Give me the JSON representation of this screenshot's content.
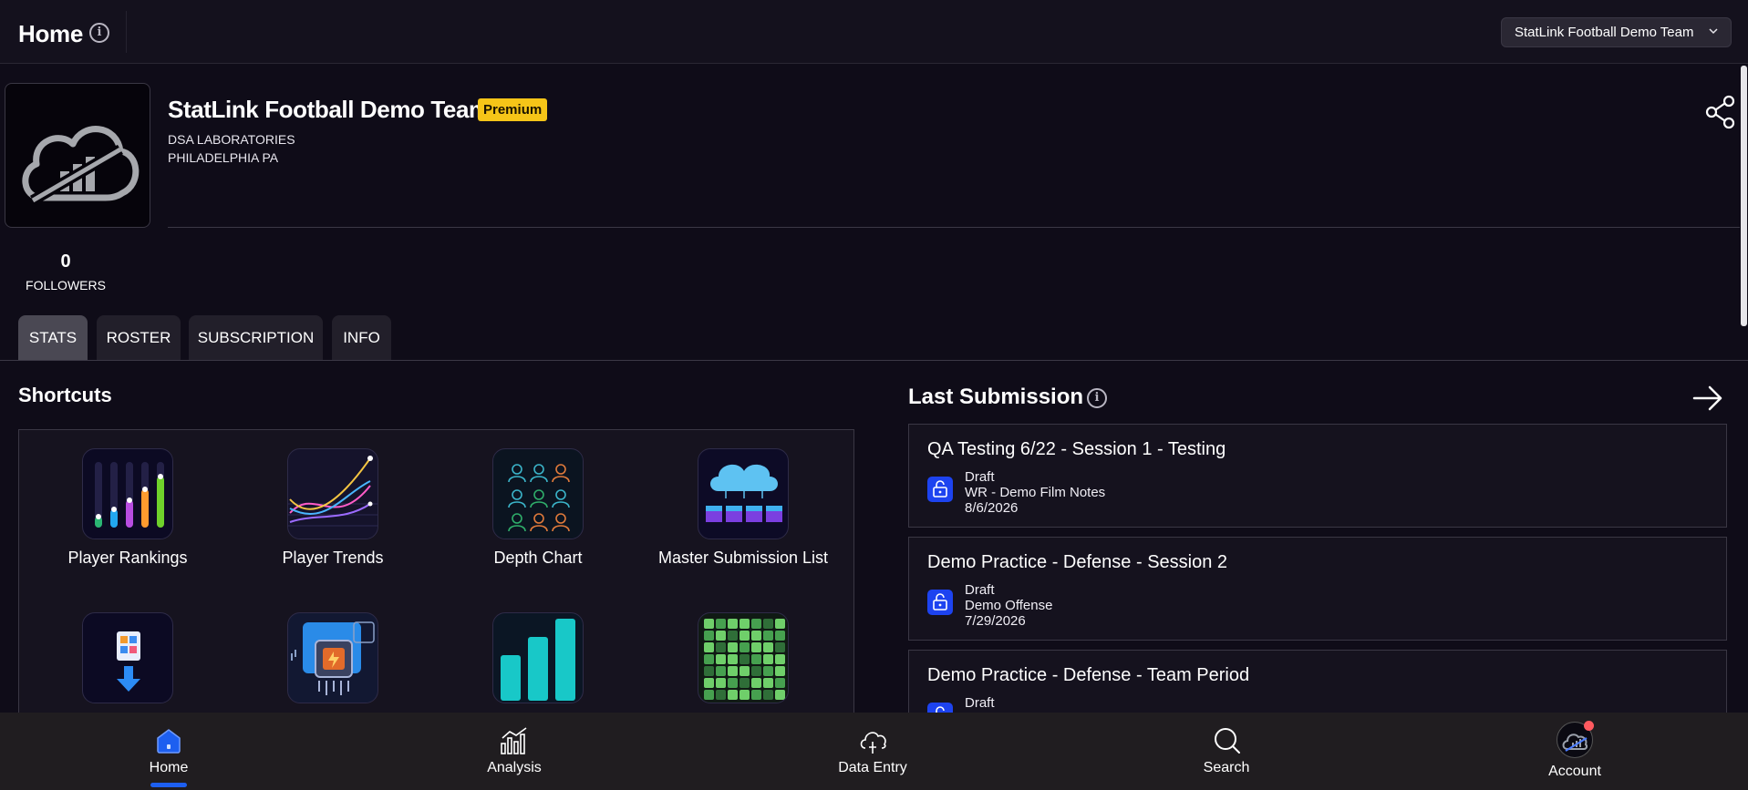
{
  "header": {
    "title": "Home",
    "team_select_value": "StatLink Football Demo Team"
  },
  "profile": {
    "team_name": "StatLink Football Demo Team",
    "badge": "Premium",
    "org": "DSA LABORATORIES",
    "location": "PHILADELPHIA PA",
    "followers_count": "0",
    "followers_label": "FOLLOWERS"
  },
  "tabs": [
    {
      "label": "STATS",
      "active": true
    },
    {
      "label": "ROSTER",
      "active": false
    },
    {
      "label": "SUBSCRIPTION",
      "active": false
    },
    {
      "label": "INFO",
      "active": false
    }
  ],
  "shortcuts": {
    "title": "Shortcuts",
    "items": [
      {
        "label": "Player Rankings",
        "icon": "player-rankings-icon"
      },
      {
        "label": "Player Trends",
        "icon": "player-trends-icon"
      },
      {
        "label": "Depth Chart",
        "icon": "depth-chart-icon"
      },
      {
        "label": "Master Submission List",
        "icon": "master-submission-list-icon"
      },
      {
        "label": "",
        "icon": "report-download-icon"
      },
      {
        "label": "",
        "icon": "processor-chip-icon"
      },
      {
        "label": "",
        "icon": "bar-chart-icon"
      },
      {
        "label": "",
        "icon": "grid-heatmap-icon"
      }
    ]
  },
  "last_submission": {
    "title": "Last Submission",
    "cards": [
      {
        "title": "QA Testing 6/22 - Session 1 - Testing",
        "status": "Draft",
        "form": "WR - Demo Film Notes",
        "date": "8/6/2026"
      },
      {
        "title": "Demo Practice - Defense - Session 2",
        "status": "Draft",
        "form": "Demo Offense",
        "date": "7/29/2026"
      },
      {
        "title": "Demo Practice - Defense - Team Period",
        "status": "Draft",
        "form": "",
        "date": ""
      }
    ]
  },
  "bottom_nav": {
    "items": [
      {
        "label": "Home",
        "icon": "home-icon",
        "active": true
      },
      {
        "label": "Analysis",
        "icon": "analysis-icon",
        "active": false
      },
      {
        "label": "Data Entry",
        "icon": "cloud-upload-icon",
        "active": false
      },
      {
        "label": "Search",
        "icon": "search-icon",
        "active": false
      },
      {
        "label": "Account",
        "icon": "avatar",
        "active": false
      }
    ]
  },
  "colors": {
    "background": "#0f0c18",
    "accent_blue": "#1d43f0",
    "premium_yellow": "#f5c518",
    "notification_red": "#ff5a5f"
  }
}
